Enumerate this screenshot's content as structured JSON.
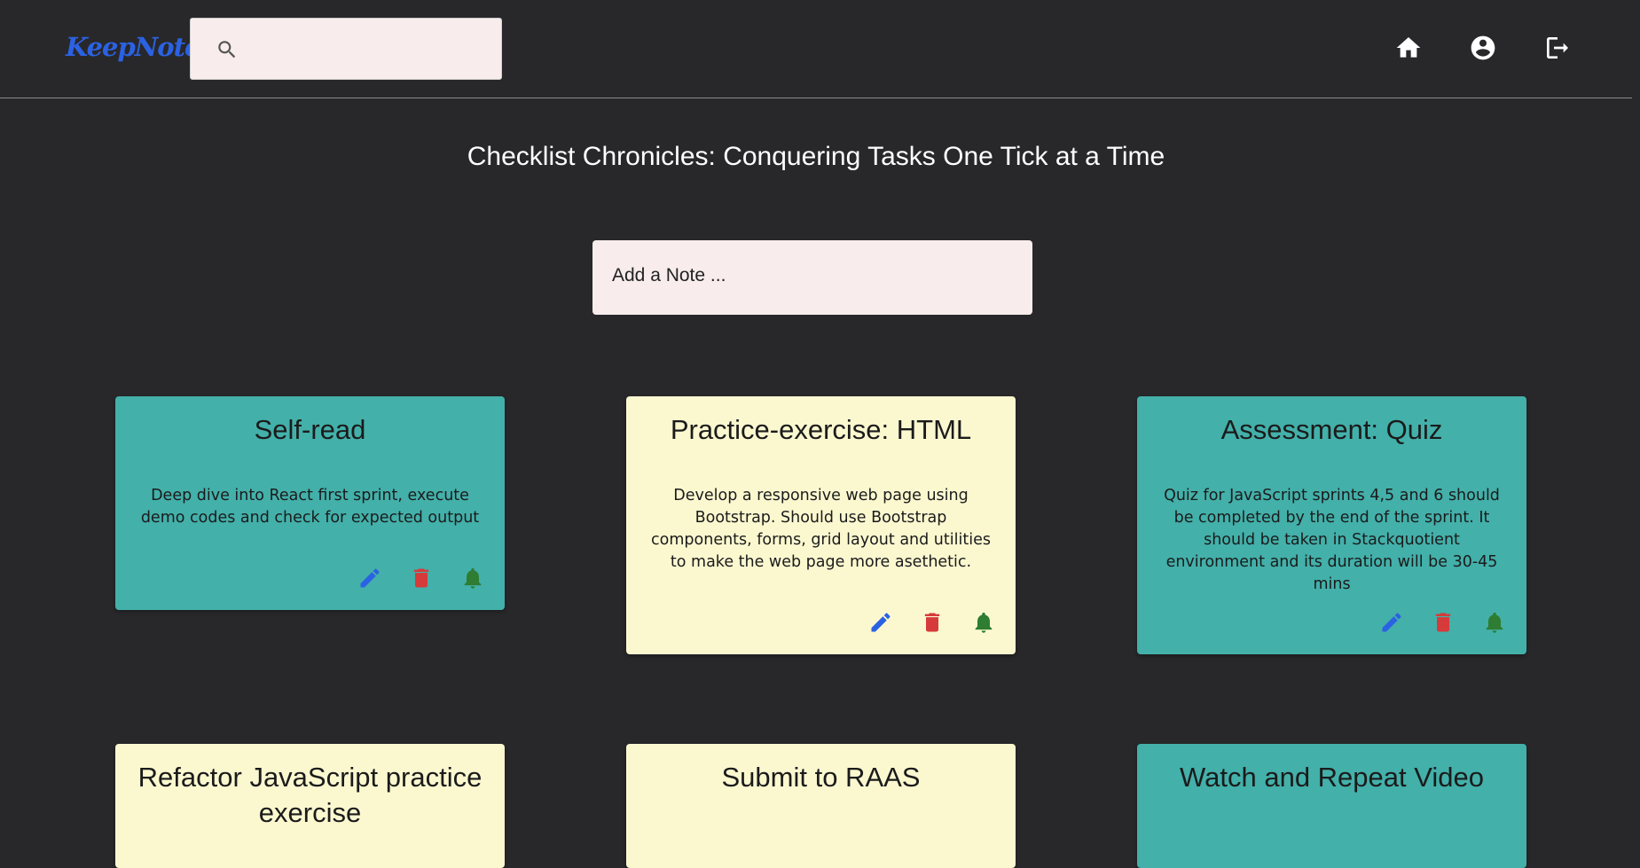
{
  "app": {
    "logo": "KeepNote"
  },
  "search": {
    "placeholder": "",
    "value": ""
  },
  "nav": {
    "home_icon": "home-icon",
    "profile_icon": "account-circle-icon",
    "logout_icon": "logout-icon"
  },
  "page": {
    "title": "Checklist Chronicles: Conquering Tasks One Tick at a Time"
  },
  "add_note": {
    "placeholder": "Add a Note ..."
  },
  "colors": {
    "teal": "#43b0aa",
    "yellow": "#fbf8d0",
    "edit": "#2b62e3",
    "delete": "#d63a3a",
    "bell": "#2e7d32",
    "logo": "#2b62e3"
  },
  "notes": [
    {
      "title": "Self-read",
      "description": "Deep dive into React first sprint, execute demo codes and check for expected output",
      "color": "teal"
    },
    {
      "title": "Practice-exercise: HTML",
      "description": "Develop a responsive web page using Bootstrap. Should use Bootstrap components, forms, grid layout and utilities to make the web page more asethetic.",
      "color": "yellow"
    },
    {
      "title": "Assessment: Quiz",
      "description": "Quiz for JavaScript sprints 4,5 and 6 should be completed by the end of the sprint. It should be taken in Stackquotient environment and its duration will be 30-45 mins",
      "color": "teal"
    },
    {
      "title": "Refactor JavaScript practice exercise",
      "description": "",
      "color": "yellow"
    },
    {
      "title": "Submit to RAAS",
      "description": "",
      "color": "yellow"
    },
    {
      "title": "Watch and Repeat Video",
      "description": "",
      "color": "teal"
    }
  ]
}
